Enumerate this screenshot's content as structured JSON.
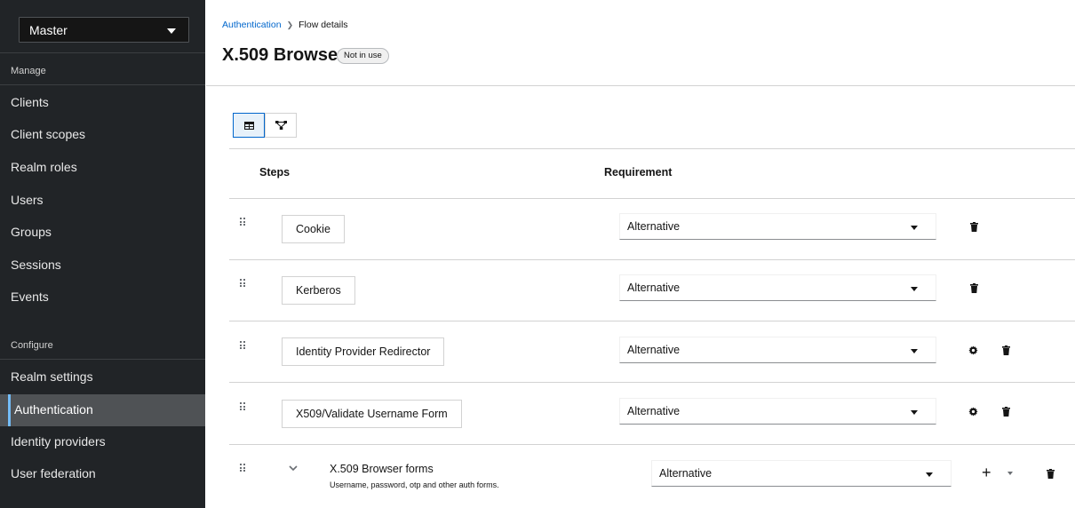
{
  "sidebar": {
    "realm": "Master",
    "manage_title": "Manage",
    "configure_title": "Configure",
    "manage_items": [
      "Clients",
      "Client scopes",
      "Realm roles",
      "Users",
      "Groups",
      "Sessions",
      "Events"
    ],
    "configure_items": [
      "Realm settings",
      "Authentication",
      "Identity providers",
      "User federation"
    ],
    "active_item": "Authentication"
  },
  "breadcrumb": {
    "parent": "Authentication",
    "current": "Flow details"
  },
  "page": {
    "title": "X.509 Browser",
    "status_badge": "Not in use"
  },
  "table": {
    "col_steps": "Steps",
    "col_requirement": "Requirement",
    "rows": [
      {
        "step": "Cookie",
        "requirement": "Alternative"
      },
      {
        "step": "Kerberos",
        "requirement": "Alternative"
      },
      {
        "step": "Identity Provider Redirector",
        "requirement": "Alternative"
      },
      {
        "step": "X509/Validate Username Form",
        "requirement": "Alternative"
      }
    ],
    "subflow": {
      "title": "X.509 Browser forms",
      "description": "Username, password, otp and other auth forms.",
      "requirement": "Alternative"
    }
  },
  "icons": {
    "table_view": "table-view-icon",
    "diagram_view": "diagram-view-icon",
    "drag": "drag-handle-icon",
    "delete": "trash-icon",
    "settings": "gear-icon",
    "add": "plus-icon",
    "expand": "chevron-down-icon"
  },
  "colors": {
    "sidebar_bg": "#212427",
    "active_nav_bg": "#4f5255",
    "active_accent": "#73bcf7",
    "link": "#0066cc"
  }
}
